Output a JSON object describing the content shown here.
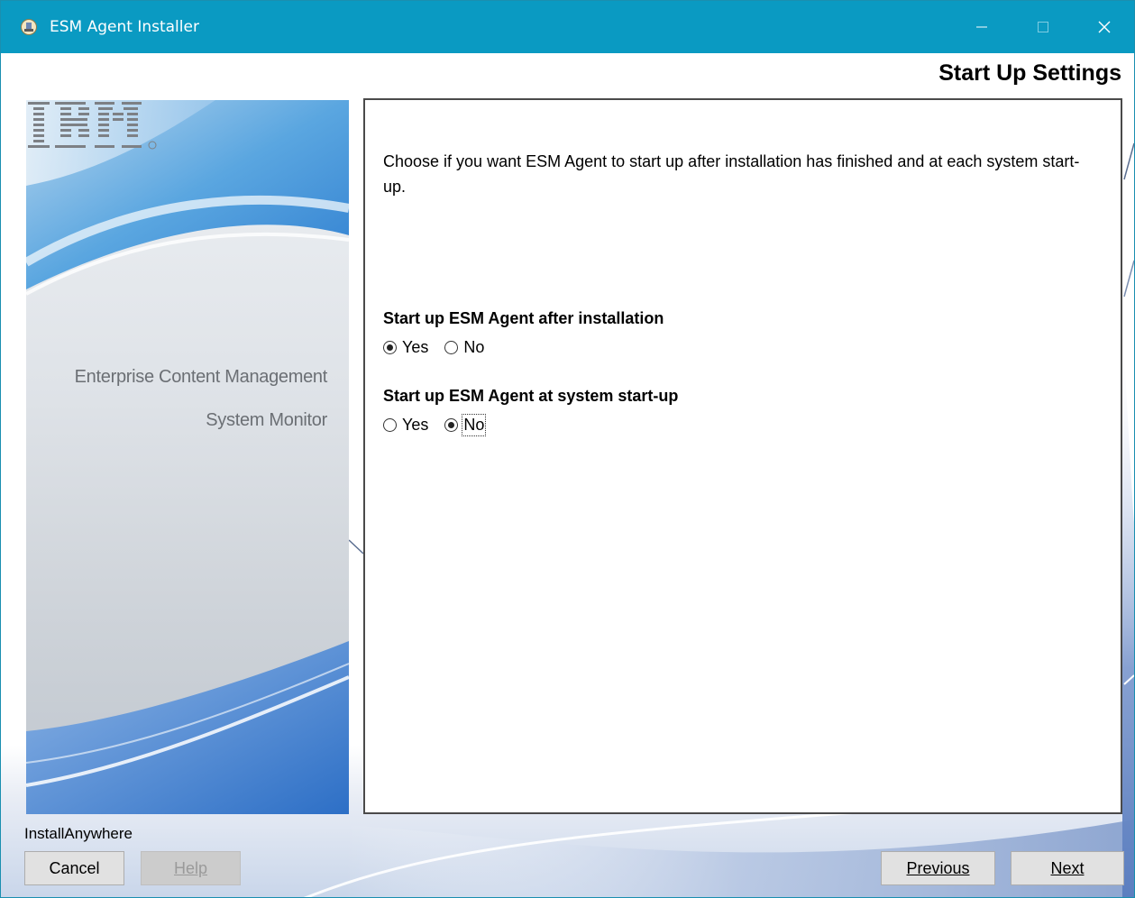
{
  "window": {
    "title": "ESM Agent Installer",
    "accent_color": "#0a9ac2",
    "controls": [
      "minimize-icon",
      "maximize-icon",
      "close-icon"
    ]
  },
  "header": {
    "title": "Start Up Settings"
  },
  "banner": {
    "logo_text": "IBM",
    "line1": "Enterprise Content Management",
    "line2": "System Monitor"
  },
  "content": {
    "description": "Choose if you want ESM Agent to start up after installation has finished and at each system start-up.",
    "question1": {
      "label": "Start up ESM Agent after installation",
      "options": [
        {
          "label": "Yes",
          "selected": true
        },
        {
          "label": "No",
          "selected": false
        }
      ]
    },
    "question2": {
      "label": "Start up ESM Agent at system start-up",
      "options": [
        {
          "label": "Yes",
          "selected": false
        },
        {
          "label": "No",
          "selected": true
        }
      ]
    }
  },
  "footer": {
    "vendor": "InstallAnywhere",
    "cancel_label": "Cancel",
    "help_label": "Help",
    "previous_label": "Previous",
    "next_label": "Next"
  }
}
